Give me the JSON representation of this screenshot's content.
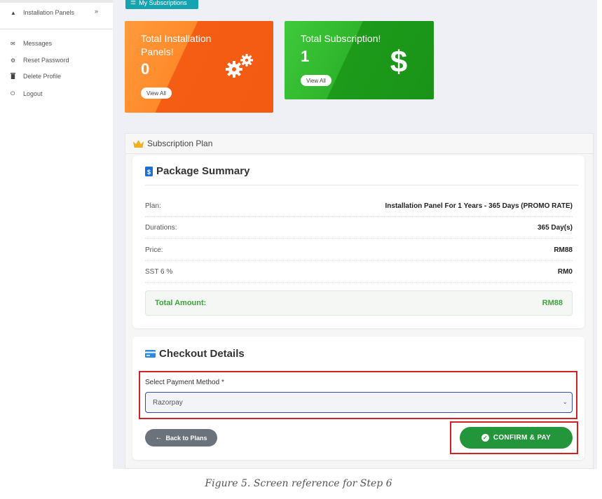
{
  "sidebar": {
    "items": [
      {
        "icon": "rocket-icon",
        "label": "Installation Panels",
        "chevron": "»"
      },
      {
        "icon": "envelope-icon",
        "label": "Messages"
      },
      {
        "icon": "gear-icon",
        "label": "Reset Password"
      },
      {
        "icon": "trash-icon",
        "label": "Delete Profile"
      },
      {
        "icon": "power-icon",
        "label": "Logout"
      }
    ]
  },
  "top_button": {
    "icon": "list-icon",
    "label": "My Subscriptions"
  },
  "cards": {
    "installation": {
      "title": "Total Installation Panels!",
      "value": "0",
      "button": "View All",
      "icon": "gears-icon",
      "color": "#f55d14"
    },
    "subscription": {
      "title": "Total Subscription!",
      "value": "1",
      "button": "View All",
      "icon": "dollar-icon",
      "color": "#1d9a1a"
    }
  },
  "panel": {
    "title": "Subscription Plan",
    "icon": "crown-icon"
  },
  "summary": {
    "title": "Package Summary",
    "icon": "document-icon",
    "rows": [
      {
        "label": "Plan:",
        "value": "Installation Panel For 1 Years - 365 Days (PROMO RATE)"
      },
      {
        "label": "Durations:",
        "value": "365 Day(s)"
      },
      {
        "label": "Price:",
        "value": "RM88"
      },
      {
        "label": "SST 6 %",
        "value": "RM0"
      }
    ],
    "total_label": "Total Amount:",
    "total_value": "RM88"
  },
  "checkout": {
    "title": "Checkout Details",
    "icon": "credit-card-icon",
    "payment_label": "Select Payment Method *",
    "payment_value": "Razorpay",
    "back_button": "Back to Plans",
    "confirm_button": "CONFIRM & PAY"
  },
  "colors": {
    "accent": "#16a3b0",
    "confirm": "#23953a",
    "highlight": "#d22027",
    "total_text": "#3ba63b"
  },
  "caption": "Figure 5. Screen reference for Step 6"
}
